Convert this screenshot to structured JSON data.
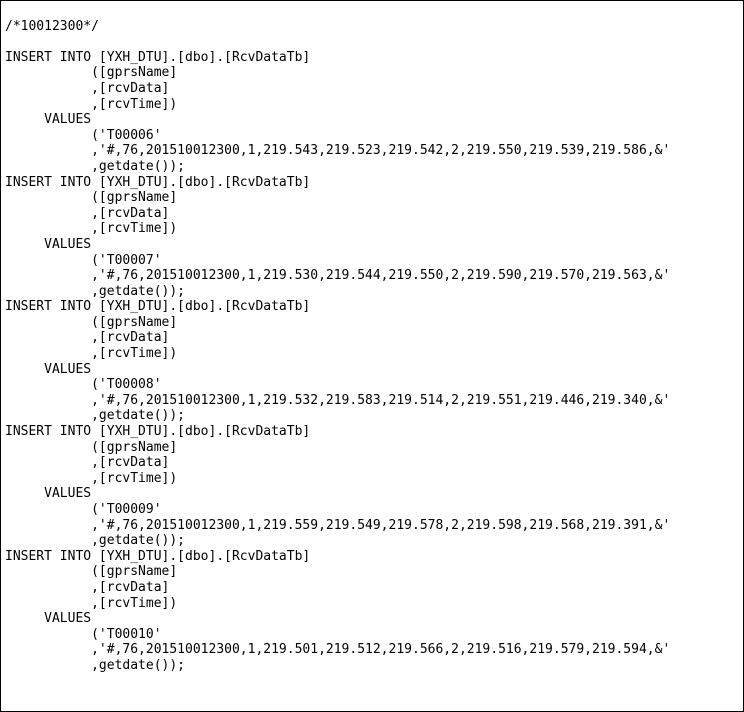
{
  "header_comment": "/*10012300*/",
  "statements": [
    {
      "insert_line": "INSERT INTO [YXH_DTU].[dbo].[RcvDataTb]",
      "col1": "           ([gprsName]",
      "col2": "           ,[rcvData]",
      "col3": "           ,[rcvTime])",
      "values_kw": "     VALUES",
      "val1": "           ('T00006'",
      "val2": "           ,'#,76,201510012300,1,219.543,219.523,219.542,2,219.550,219.539,219.586,&'",
      "val3": "           ,getdate());"
    },
    {
      "insert_line": "INSERT INTO [YXH_DTU].[dbo].[RcvDataTb]",
      "col1": "           ([gprsName]",
      "col2": "           ,[rcvData]",
      "col3": "           ,[rcvTime])",
      "values_kw": "     VALUES",
      "val1": "           ('T00007'",
      "val2": "           ,'#,76,201510012300,1,219.530,219.544,219.550,2,219.590,219.570,219.563,&'",
      "val3": "           ,getdate());"
    },
    {
      "insert_line": "INSERT INTO [YXH_DTU].[dbo].[RcvDataTb]",
      "col1": "           ([gprsName]",
      "col2": "           ,[rcvData]",
      "col3": "           ,[rcvTime])",
      "values_kw": "     VALUES",
      "val1": "           ('T00008'",
      "val2": "           ,'#,76,201510012300,1,219.532,219.583,219.514,2,219.551,219.446,219.340,&'",
      "val3": "           ,getdate());"
    },
    {
      "insert_line": "INSERT INTO [YXH_DTU].[dbo].[RcvDataTb]",
      "col1": "           ([gprsName]",
      "col2": "           ,[rcvData]",
      "col3": "           ,[rcvTime])",
      "values_kw": "     VALUES",
      "val1": "           ('T00009'",
      "val2": "           ,'#,76,201510012300,1,219.559,219.549,219.578,2,219.598,219.568,219.391,&'",
      "val3": "           ,getdate());"
    },
    {
      "insert_line": "INSERT INTO [YXH_DTU].[dbo].[RcvDataTb]",
      "col1": "           ([gprsName]",
      "col2": "           ,[rcvData]",
      "col3": "           ,[rcvTime])",
      "values_kw": "     VALUES",
      "val1": "           ('T00010'",
      "val2": "           ,'#,76,201510012300,1,219.501,219.512,219.566,2,219.516,219.579,219.594,&'",
      "val3": "           ,getdate());"
    }
  ],
  "blank_after": [
    true,
    true,
    false,
    false,
    false
  ],
  "blank_before_values": [
    false,
    false,
    true,
    false,
    false
  ]
}
